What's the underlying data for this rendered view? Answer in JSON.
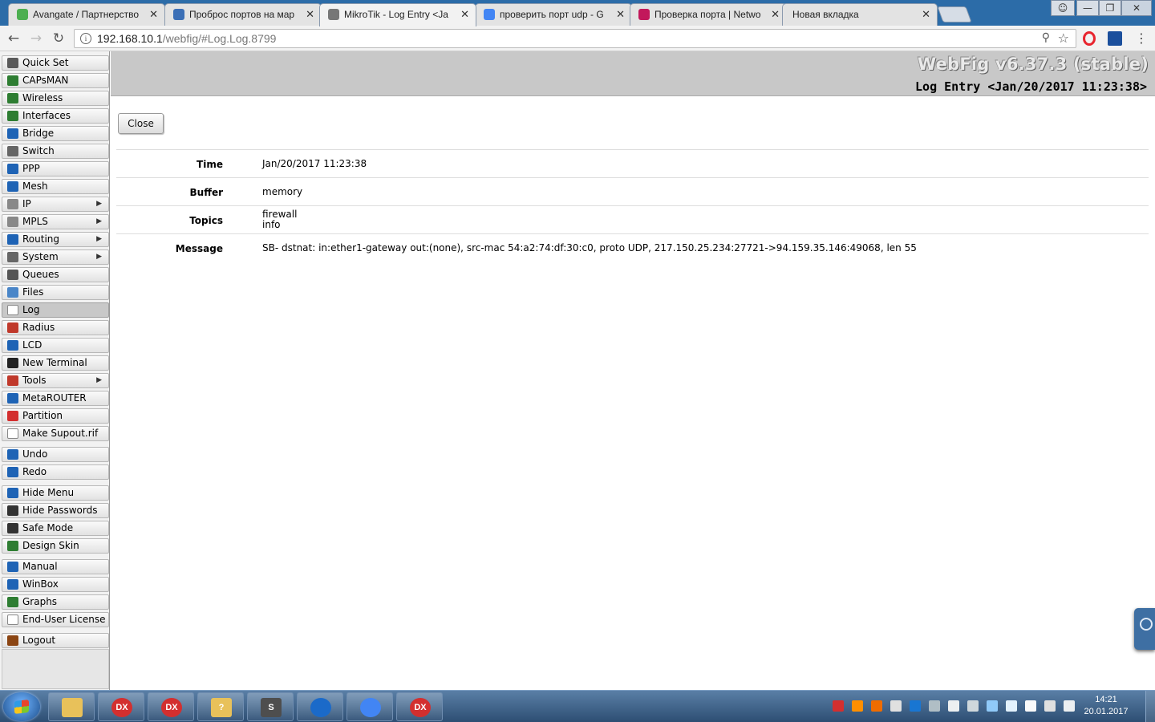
{
  "browser": {
    "tabs": [
      {
        "label": "Avangate / Партнерство",
        "icon": "avangate-icon",
        "color": "#4caf50"
      },
      {
        "label": "Проброс портов на мар",
        "icon": "mikrotik-forum-icon",
        "color": "#3b6fb6"
      },
      {
        "label": "MikroTik - Log Entry <Ja",
        "icon": "document-icon",
        "color": "#777777"
      },
      {
        "label": "проверить порт udp - G",
        "icon": "google-icon",
        "color": "#4285f4"
      },
      {
        "label": "Проверка порта | Netwo",
        "icon": "portcheck-icon",
        "color": "#c2185b"
      },
      {
        "label": "Новая вкладка",
        "icon": "",
        "color": "#777777"
      }
    ],
    "url_host": "192.168.10.1",
    "url_path": "/webfig/#Log.Log.8799"
  },
  "webfig": {
    "version": "WebFig v6.37.3 (stable)",
    "page_title": "Log Entry <Jan/20/2017 11:23:38>",
    "close_label": "Close",
    "menu": [
      {
        "label": "Quick Set",
        "icon": "quick-set-icon",
        "color": "#5a5a5a"
      },
      {
        "label": "CAPsMAN",
        "icon": "capsman-icon",
        "color": "#2e7d32"
      },
      {
        "label": "Wireless",
        "icon": "wireless-icon",
        "color": "#2e7d32"
      },
      {
        "label": "Interfaces",
        "icon": "interfaces-icon",
        "color": "#2e7d32"
      },
      {
        "label": "Bridge",
        "icon": "bridge-icon",
        "color": "#1e63b5"
      },
      {
        "label": "Switch",
        "icon": "switch-icon",
        "color": "#666666"
      },
      {
        "label": "PPP",
        "icon": "ppp-icon",
        "color": "#1e63b5"
      },
      {
        "label": "Mesh",
        "icon": "mesh-icon",
        "color": "#1e63b5"
      },
      {
        "label": "IP",
        "icon": "ip-icon",
        "color": "#888888",
        "submenu": "▶"
      },
      {
        "label": "MPLS",
        "icon": "mpls-icon",
        "color": "#888888",
        "submenu": "▶"
      },
      {
        "label": "Routing",
        "icon": "routing-icon",
        "color": "#1e63b5",
        "submenu": "▶"
      },
      {
        "label": "System",
        "icon": "system-icon",
        "color": "#666666",
        "submenu": "▶"
      },
      {
        "label": "Queues",
        "icon": "queues-icon",
        "color": "#555555"
      },
      {
        "label": "Files",
        "icon": "files-icon",
        "color": "#4a86c8"
      },
      {
        "label": "Log",
        "icon": "log-icon",
        "color": "#ffffff"
      },
      {
        "label": "Radius",
        "icon": "radius-icon",
        "color": "#c0392b"
      },
      {
        "label": "LCD",
        "icon": "lcd-icon",
        "color": "#1e63b5"
      },
      {
        "label": "New Terminal",
        "icon": "terminal-icon",
        "color": "#222222"
      },
      {
        "label": "Tools",
        "icon": "tools-icon",
        "color": "#c0392b",
        "submenu": "▶"
      },
      {
        "label": "MetaROUTER",
        "icon": "metarouter-icon",
        "color": "#1e63b5"
      },
      {
        "label": "Partition",
        "icon": "partition-icon",
        "color": "#d32f2f"
      },
      {
        "label": "Make Supout.rif",
        "icon": "supout-icon",
        "color": "#ffffff"
      },
      {
        "label": "Undo",
        "icon": "undo-icon",
        "color": "#1e63b5"
      },
      {
        "label": "Redo",
        "icon": "redo-icon",
        "color": "#1e63b5"
      },
      {
        "label": "Hide Menu",
        "icon": "hide-menu-icon",
        "color": "#1e63b5"
      },
      {
        "label": "Hide Passwords",
        "icon": "hide-passwords-icon",
        "color": "#333333"
      },
      {
        "label": "Safe Mode",
        "icon": "safe-mode-icon",
        "color": "#333333"
      },
      {
        "label": "Design Skin",
        "icon": "design-skin-icon",
        "color": "#2e7d32"
      },
      {
        "label": "Manual",
        "icon": "manual-icon",
        "color": "#1e63b5"
      },
      {
        "label": "WinBox",
        "icon": "winbox-icon",
        "color": "#1e63b5"
      },
      {
        "label": "Graphs",
        "icon": "graphs-icon",
        "color": "#2e7d32"
      },
      {
        "label": "End-User License",
        "icon": "license-icon",
        "color": "#ffffff"
      },
      {
        "label": "Logout",
        "icon": "logout-icon",
        "color": "#8b4513"
      }
    ],
    "fields": [
      {
        "label": "Time",
        "value": [
          "Jan/20/2017 11:23:38"
        ]
      },
      {
        "label": "Buffer",
        "value": [
          "memory"
        ]
      },
      {
        "label": "Topics",
        "value": [
          "firewall",
          "info"
        ]
      },
      {
        "label": "Message",
        "value": [
          "SB- dstnat: in:ether1-gateway out:(none), src-mac 54:a2:74:df:30:c0, proto UDP, 217.150.25.234:27721->94.159.35.146:49068, len 55"
        ]
      }
    ]
  },
  "taskbar": {
    "apps": [
      {
        "name": "explorer",
        "label": "",
        "color": "#e8c15a"
      },
      {
        "name": "dx-1",
        "label": "DX",
        "color": "#d32f2f"
      },
      {
        "name": "dx-2",
        "label": "DX",
        "color": "#d32f2f"
      },
      {
        "name": "help",
        "label": "?",
        "color": "#e8c15a"
      },
      {
        "name": "sublime",
        "label": "S",
        "color": "#4e4e4e"
      },
      {
        "name": "teamviewer",
        "label": "",
        "color": "#1b6ac9"
      },
      {
        "name": "chrome",
        "label": "",
        "color": "#4285f4"
      },
      {
        "name": "dx-3",
        "label": "DX",
        "color": "#d32f2f"
      }
    ],
    "time": "14:21",
    "date": "20.01.2017"
  }
}
